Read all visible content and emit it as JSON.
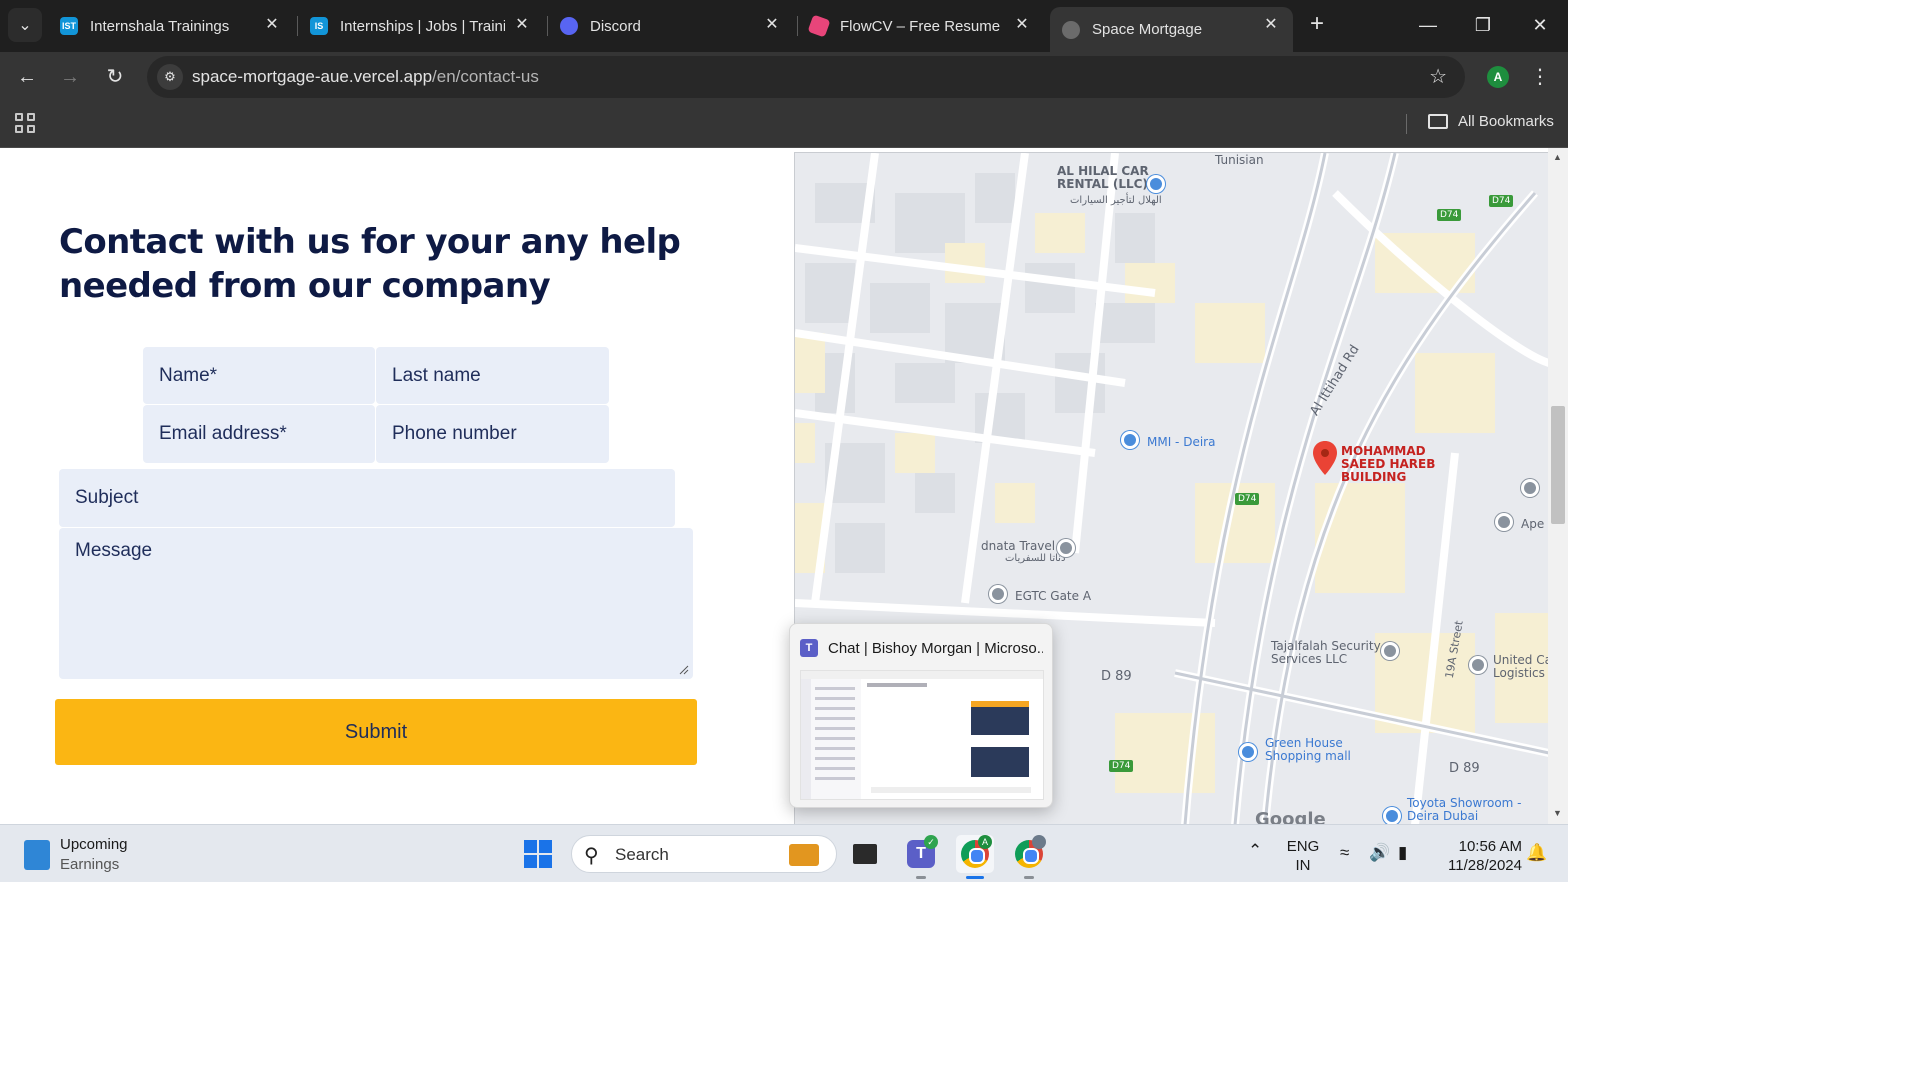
{
  "browser": {
    "tabs": [
      {
        "title": "Internshala Trainings",
        "favicon_text": "IST",
        "favicon_color": "#1295d8",
        "active": false
      },
      {
        "title": "Internships | Jobs | Trainin",
        "favicon_text": "IS",
        "favicon_color": "#1295d8",
        "active": false
      },
      {
        "title": "Discord",
        "favicon_text": "",
        "favicon_color": "#5865f2",
        "active": false
      },
      {
        "title": "FlowCV – Free Resume Bu",
        "favicon_text": "",
        "favicon_color": "#e8457a",
        "active": false
      },
      {
        "title": "Space Mortgage",
        "favicon_text": "",
        "favicon_color": "#6b6b6b",
        "active": true
      }
    ],
    "url_host": "space-mortgage-aue.vercel.app",
    "url_path": "/en/contact-us",
    "profile_initial": "A",
    "bookmarks_label": "All Bookmarks"
  },
  "page": {
    "heading": "Contact with us for your any help needed from our company",
    "form": {
      "name_placeholder": "Name*",
      "last_name_placeholder": "Last name",
      "email_placeholder": "Email address*",
      "phone_placeholder": "Phone number",
      "subject_placeholder": "Subject",
      "message_placeholder": "Message",
      "submit_label": "Submit"
    },
    "map": {
      "labels": {
        "tunisian": "Tunisian",
        "al_hilal": "AL HILAL CAR RENTAL (LLC)",
        "al_hilal_ar": "الهلال لتأجير السيارات",
        "mmi": "MMI - Deira",
        "al_ittihad": "Al Ittihad Rd",
        "mohammad": "MOHAMMAD SAEED HAREB BUILDING",
        "dnata": "dnata Travel",
        "dnata_ar": "دناتا للسفريات",
        "egtc": "EGTC Gate A",
        "tajalfalah": "Tajalfalah Security Services LLC",
        "united": "United Ca Logistics",
        "green_house": "Green House Shopping mall",
        "toyota": "Toyota Showroom - Deira Dubai",
        "street_19a": "19A Street",
        "ape": "Ape",
        "d89_a": "D 89",
        "d89_b": "D 89",
        "d74_a": "D74",
        "d74_b": "D74",
        "d74_c": "D74",
        "d74_d": "D74",
        "google": "Google"
      }
    }
  },
  "popup": {
    "title": "Chat | Bishoy Morgan | Microso..."
  },
  "taskbar": {
    "widget_line1": "Upcoming",
    "widget_line2": "Earnings",
    "search_label": "Search",
    "lang_line1": "ENG",
    "lang_line2": "IN",
    "time": "10:56 AM",
    "date": "11/28/2024"
  },
  "colors": {
    "accent_submit": "#fbb613",
    "heading": "#0e1a44",
    "field_bg": "#e9eef8"
  }
}
